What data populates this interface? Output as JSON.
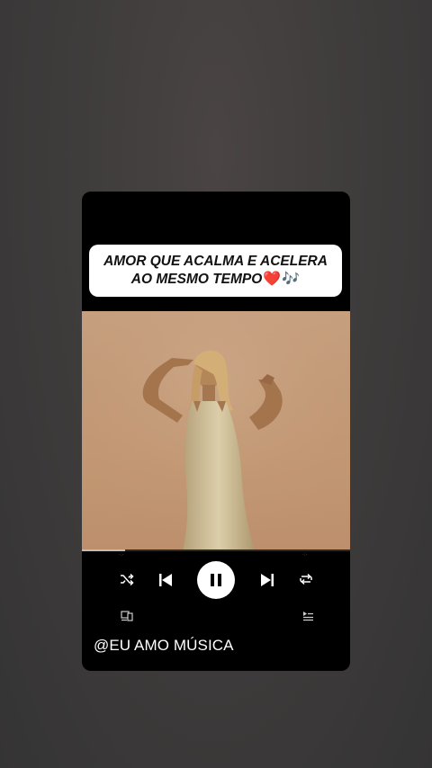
{
  "post": {
    "caption_line1": "AMOR QUE ACALMA E ACELERA",
    "caption_line2": "AO MESMO TEMPO",
    "caption_emoji_heart": "❤️",
    "caption_emoji_notes": "🎶",
    "handle": "@EU AMO MÚSICA"
  },
  "player": {
    "state": "playing",
    "progress": 0.16,
    "icons": {
      "shuffle": "shuffle-icon",
      "previous": "skip-previous-icon",
      "play_pause": "pause-icon",
      "next": "skip-next-icon",
      "repeat": "repeat-icon",
      "devices": "connect-device-icon",
      "queue": "queue-icon"
    }
  },
  "colors": {
    "background": "#3f3c3c",
    "card": "#000000",
    "caption_bg": "#ffffff",
    "heart": "#e0242f",
    "notes": "#8b3fd0",
    "desert": "#c69b76"
  }
}
